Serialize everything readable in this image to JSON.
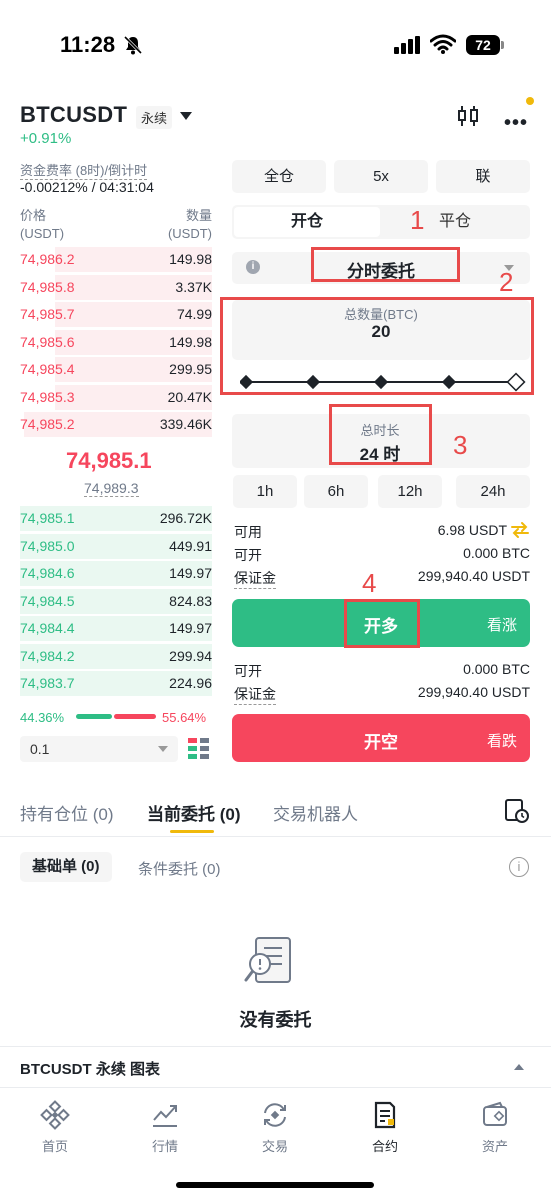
{
  "status": {
    "time": "11:28",
    "battery": "72"
  },
  "header": {
    "symbol": "BTCUSDT",
    "contract": "永续",
    "change": "+0.91%"
  },
  "funding": {
    "label": "资金费率 (8时)/倒计时",
    "value": "-0.00212% / 04:31:04"
  },
  "orderbook": {
    "price_label": "价格",
    "price_unit": "(USDT)",
    "qty_label": "数量",
    "qty_unit": "(USDT)",
    "asks": [
      {
        "price": "74,986.2",
        "qty": "149.98",
        "depth": 0.82
      },
      {
        "price": "74,985.8",
        "qty": "3.37K",
        "depth": 0.82
      },
      {
        "price": "74,985.7",
        "qty": "74.99",
        "depth": 0.82
      },
      {
        "price": "74,985.6",
        "qty": "149.98",
        "depth": 0.82
      },
      {
        "price": "74,985.4",
        "qty": "299.95",
        "depth": 0.82
      },
      {
        "price": "74,985.3",
        "qty": "20.47K",
        "depth": 0.82
      },
      {
        "price": "74,985.2",
        "qty": "339.46K",
        "depth": 0.98
      }
    ],
    "mid_price": "74,985.1",
    "mark_price": "74,989.3",
    "bids": [
      {
        "price": "74,985.1",
        "qty": "296.72K",
        "depth": 1.0
      },
      {
        "price": "74,985.0",
        "qty": "449.91",
        "depth": 1.0
      },
      {
        "price": "74,984.6",
        "qty": "149.97",
        "depth": 1.0
      },
      {
        "price": "74,984.5",
        "qty": "824.83",
        "depth": 1.0
      },
      {
        "price": "74,984.4",
        "qty": "149.97",
        "depth": 1.0
      },
      {
        "price": "74,984.2",
        "qty": "299.94",
        "depth": 1.0
      },
      {
        "price": "74,983.7",
        "qty": "224.96",
        "depth": 1.0
      }
    ],
    "buy_ratio": "44.36%",
    "sell_ratio": "55.64%",
    "precision": "0.1"
  },
  "order": {
    "margin_mode": "全仓",
    "leverage": "5x",
    "mode_link": "联",
    "open_label": "开仓",
    "close_label": "平仓",
    "order_type": "分时委托",
    "qty_label": "总数量(BTC)",
    "qty_value": "20",
    "duration_label": "总时长",
    "duration_value": "24 时",
    "presets": [
      "1h",
      "6h",
      "12h",
      "24h"
    ],
    "available_label": "可用",
    "available_value": "6.98 USDT",
    "long_openable_label": "可开",
    "long_openable_value": "0.000 BTC",
    "long_margin_label": "保证金",
    "long_margin_value": "299,940.40 USDT",
    "long_button": "开多",
    "long_side": "看涨",
    "short_openable_label": "可开",
    "short_openable_value": "0.000 BTC",
    "short_margin_label": "保证金",
    "short_margin_value": "299,940.40 USDT",
    "short_button": "开空",
    "short_side": "看跌"
  },
  "annotations": [
    "1",
    "2",
    "3",
    "4"
  ],
  "tabs": {
    "positions": "持有仓位 (0)",
    "open_orders": "当前委托 (0)",
    "bots": "交易机器人",
    "basic": "基础单 (0)",
    "conditional": "条件委托 (0)",
    "empty": "没有委托"
  },
  "chart_bar": {
    "label": "BTCUSDT 永续 图表"
  },
  "nav": [
    {
      "label": "首页",
      "icon": "home-icon"
    },
    {
      "label": "行情",
      "icon": "markets-icon"
    },
    {
      "label": "交易",
      "icon": "trade-icon"
    },
    {
      "label": "合约",
      "icon": "futures-icon"
    },
    {
      "label": "资产",
      "icon": "wallet-icon"
    }
  ],
  "colors": {
    "green": "#2ebd85",
    "red": "#f6465d",
    "accent": "#f0b90b",
    "annotation": "#e84a4a"
  }
}
